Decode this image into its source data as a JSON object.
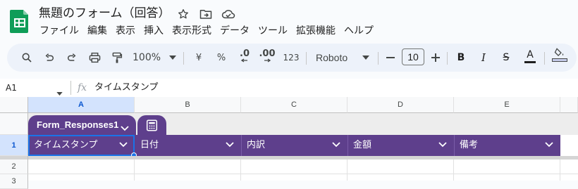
{
  "document": {
    "title": "無題のフォーム（回答）",
    "app_icon": "google-sheets-icon",
    "title_icons": [
      "star-icon",
      "move-to-folder-icon",
      "cloud-saved-icon"
    ]
  },
  "menu": [
    "ファイル",
    "編集",
    "表示",
    "挿入",
    "表示形式",
    "データ",
    "ツール",
    "拡張機能",
    "ヘルプ"
  ],
  "toolbar": {
    "zoom": "100%",
    "currency_symbol": "¥",
    "percent_symbol": "%",
    "decrease_decimal": ".0",
    "increase_decimal": ".00",
    "number_format": "123",
    "font_name": "Roboto",
    "font_size": "10",
    "bold_label": "B",
    "italic_label": "I",
    "strikethrough_label": "S",
    "text_color_label": "A",
    "icons": [
      "search-icon",
      "undo-icon",
      "redo-icon",
      "print-icon",
      "paint-format-icon",
      "text-color-icon",
      "fill-color-icon"
    ]
  },
  "formula_bar": {
    "cell_ref": "A1",
    "fx_label": "fx",
    "content": "タイムスタンプ"
  },
  "grid": {
    "columns": [
      "A",
      "B",
      "C",
      "D",
      "E"
    ],
    "selected_column": "A",
    "rows": [
      "1",
      "2",
      "3"
    ],
    "selected_row": "1"
  },
  "table": {
    "name": "Form_Responses1",
    "headers": [
      "タイムスタンプ",
      "日付",
      "内訳",
      "金額",
      "備考"
    ]
  },
  "colors": {
    "table_header": "#5e3f8c",
    "selection": "#1a73e8",
    "sheets_green": "#0f9d58",
    "toolbar_bg": "#edf2fa"
  }
}
